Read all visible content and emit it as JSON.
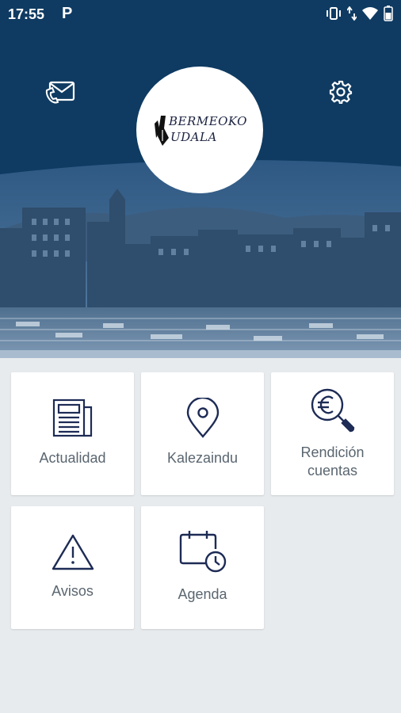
{
  "status_bar": {
    "time": "17:55",
    "notification_icon": "P",
    "icons": [
      "vibrate-icon",
      "data-arrows-icon",
      "wifi-icon",
      "battery-icon"
    ]
  },
  "header": {
    "contact_icon": "mail-phone-icon",
    "settings_icon": "gear-icon",
    "logo": {
      "line1": "BERMEOKO",
      "line2": "UDALA"
    },
    "brand_color": "#0f3b62"
  },
  "tiles": [
    {
      "label": "Actualidad",
      "icon": "newspaper-icon"
    },
    {
      "label": "Kalezaindu",
      "icon": "location-pin-icon"
    },
    {
      "label_line1": "Rendición",
      "label_line2": "cuentas",
      "icon": "euro-search-icon"
    },
    {
      "label": "Avisos",
      "icon": "warning-icon"
    },
    {
      "label": "Agenda",
      "icon": "calendar-clock-icon"
    }
  ],
  "colors": {
    "icon": "#1d2b55",
    "label": "#5a6670",
    "background": "#e7ebee"
  }
}
